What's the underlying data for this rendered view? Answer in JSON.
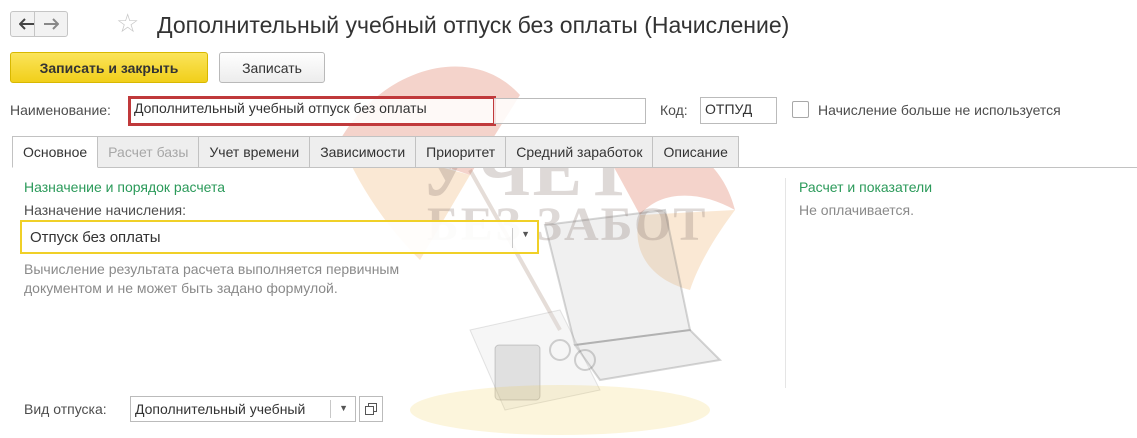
{
  "window": {
    "title": "Дополнительный учебный отпуск без оплаты (Начисление)"
  },
  "toolbar": {
    "save_close_label": "Записать и закрыть",
    "save_label": "Записать"
  },
  "header_fields": {
    "name_label": "Наименование:",
    "name_value": "Дополнительный учебный отпуск без оплаты",
    "code_label": "Код:",
    "code_value": "ОТПУД",
    "not_used_label": "Начисление больше не используется",
    "not_used_checked": false
  },
  "tabs": [
    {
      "label": "Основное",
      "state": "active"
    },
    {
      "label": "Расчет базы",
      "state": "disabled"
    },
    {
      "label": "Учет времени",
      "state": "normal"
    },
    {
      "label": "Зависимости",
      "state": "normal"
    },
    {
      "label": "Приоритет",
      "state": "normal"
    },
    {
      "label": "Средний заработок",
      "state": "normal"
    },
    {
      "label": "Описание",
      "state": "normal"
    }
  ],
  "main": {
    "section_title": "Назначение и порядок расчета",
    "purpose_label": "Назначение начисления:",
    "purpose_value": "Отпуск без оплаты",
    "calc_hint_line1": "Вычисление результата расчета выполняется первичным",
    "calc_hint_line2": "документом и не может быть задано формулой.",
    "leave_type_label": "Вид отпуска:",
    "leave_type_value": "Дополнительный учебный"
  },
  "right_panel": {
    "section_title": "Расчет и показатели",
    "status_text": "Не оплачивается."
  },
  "watermark": {
    "line1": "УЧЕТ",
    "line2": "БЕЗ ЗАБОТ"
  },
  "colors": {
    "primary_button": "#f6d933",
    "section_title": "#2b9a5a",
    "highlight_border": "#c0393b",
    "combo_focus_border": "#f0d028"
  },
  "icons": {
    "back": "arrow-left-icon",
    "forward": "arrow-right-icon",
    "favorite": "star-icon",
    "dropdown": "chevron-down-icon",
    "open": "open-form-icon"
  }
}
